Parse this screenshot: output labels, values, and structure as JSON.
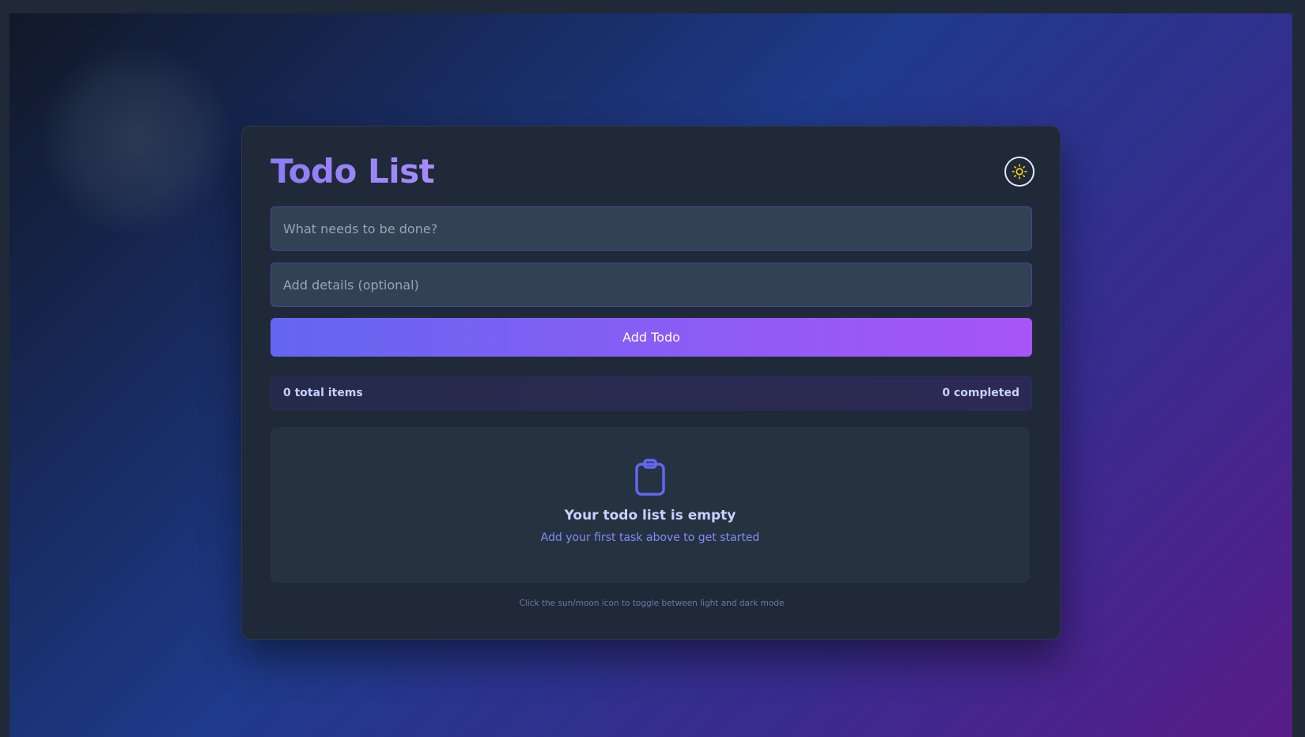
{
  "app": {
    "title": "Todo List"
  },
  "theme_toggle": {
    "icon": "sun-icon",
    "icon_color": "#facc15"
  },
  "form": {
    "title_placeholder": "What needs to be done?",
    "title_value": "",
    "details_placeholder": "Add details (optional)",
    "details_value": "",
    "add_button_label": "Add Todo"
  },
  "stats": {
    "total_label": "0 total items",
    "completed_label": "0 completed"
  },
  "empty_state": {
    "icon": "clipboard-icon",
    "title": "Your todo list is empty",
    "subtitle": "Add your first task above to get started"
  },
  "hint": "Click the sun/moon icon to toggle between light and dark mode",
  "colors": {
    "accent_start": "#6366f1",
    "accent_end": "#a855f7",
    "card_bg": "#1f2937",
    "input_bg": "#334155"
  }
}
